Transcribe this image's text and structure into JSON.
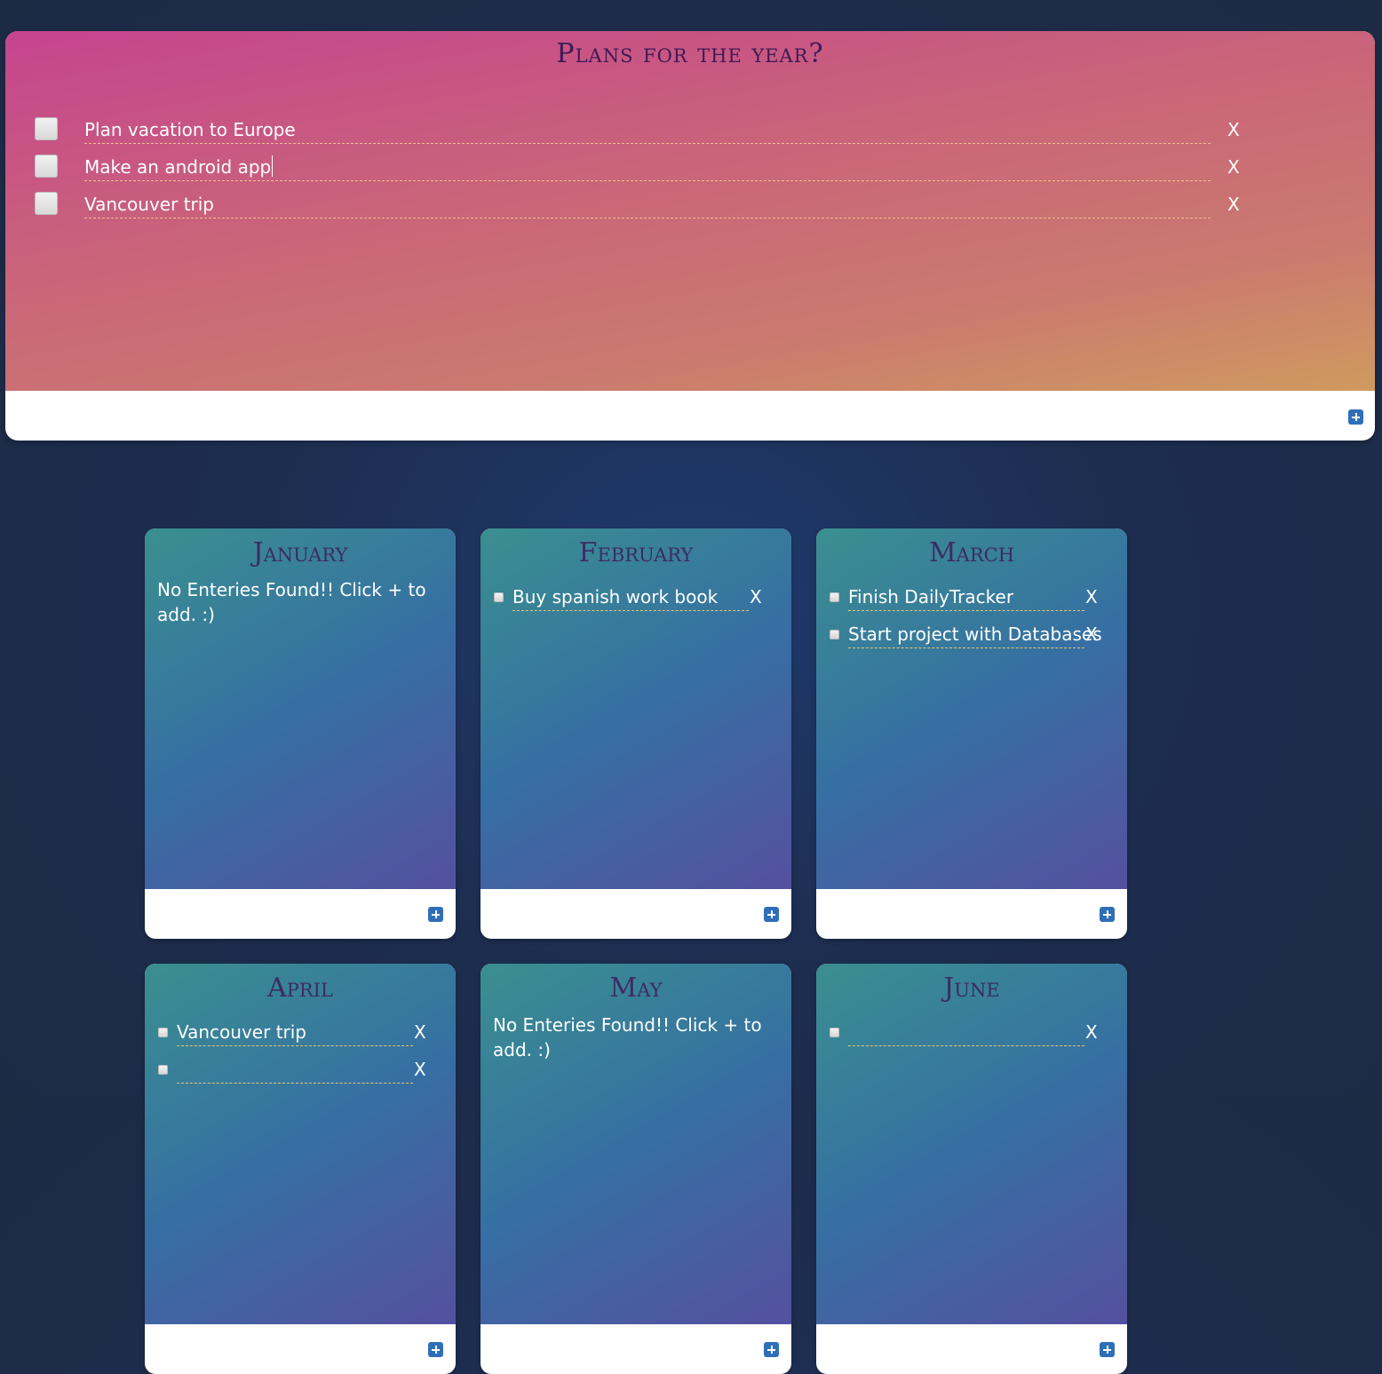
{
  "year": {
    "title": "Plans for the year?",
    "items": [
      {
        "text": "Plan vacation to Europe",
        "delete": "X"
      },
      {
        "text": "Make an android app",
        "delete": "X"
      },
      {
        "text": "Vancouver trip",
        "delete": "X"
      }
    ]
  },
  "months": {
    "january": {
      "title": "January",
      "empty_message": "No Enteries Found!! Click + to add. :)"
    },
    "february": {
      "title": "February",
      "items": [
        {
          "text": "Buy spanish work book",
          "delete": "X"
        }
      ]
    },
    "march": {
      "title": "March",
      "items": [
        {
          "text": "Finish DailyTracker",
          "delete": "X"
        },
        {
          "text": "Start project with Databases",
          "delete": "X"
        }
      ]
    },
    "april": {
      "title": "April",
      "items": [
        {
          "text": "Vancouver trip",
          "delete": "X"
        },
        {
          "text": "",
          "delete": "X"
        }
      ]
    },
    "may": {
      "title": "May",
      "empty_message": "No Enteries Found!! Click + to add. :)"
    },
    "june": {
      "title": "June",
      "items": [
        {
          "text": "",
          "delete": "X"
        }
      ]
    }
  },
  "colors": {
    "year_gradient_start": "#c6448f",
    "year_gradient_end": "#cf9a5f",
    "month_gradient_start": "#3a8f90",
    "month_gradient_end": "#5550a0",
    "add_button": "#2f6fb8",
    "title_text": "#3d1a55"
  },
  "icons": {
    "add": "plus-square-icon",
    "delete": "x-icon"
  }
}
